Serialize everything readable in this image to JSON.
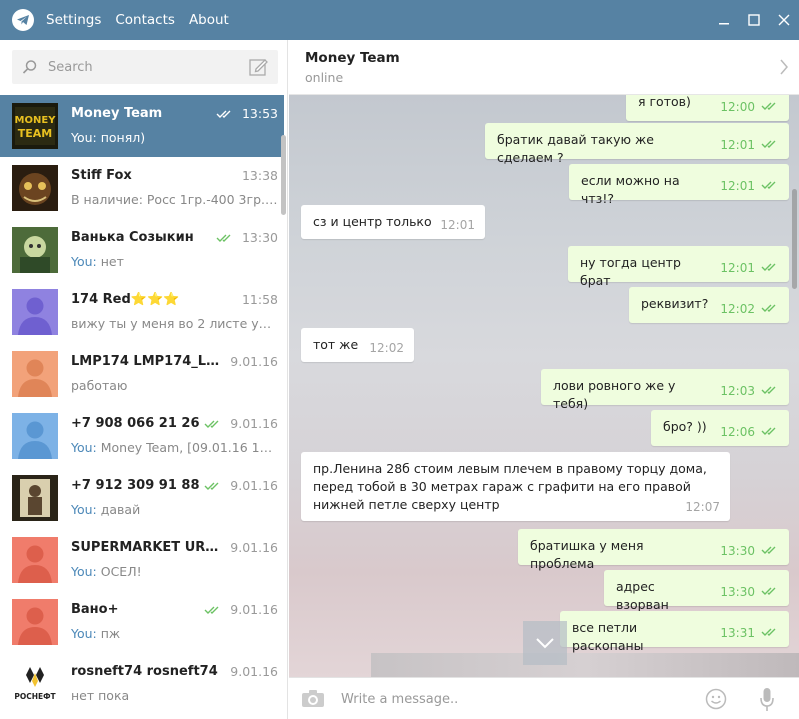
{
  "menu": {
    "settings": "Settings",
    "contacts": "Contacts",
    "about": "About"
  },
  "search": {
    "placeholder": "Search"
  },
  "dialogs": [
    {
      "name": "Money Team",
      "time": "13:53",
      "you": "You:",
      "text": " понял)",
      "read": true,
      "avatar": "money-team"
    },
    {
      "name": "Stiff Fox",
      "time": "13:38",
      "you": "",
      "text": "В наличие: Росс 1гр.-400 3гр.-70...",
      "read": false,
      "avatar": "stiff-fox"
    },
    {
      "name": "Ванька Созыкин",
      "time": "13:30",
      "you": "You:",
      "text": " нет",
      "read": true,
      "avatar": "vanka"
    },
    {
      "name": "174 Red",
      "stars": "⭐⭐⭐",
      "time": "11:58",
      "you": "",
      "text": "вижу ты у меня во 2 листе уже с...",
      "read": false,
      "avatar": "purple"
    },
    {
      "name": "LMP174 LMP174_LEGAL",
      "time": "9.01.16",
      "you": "",
      "text": "работаю",
      "read": false,
      "avatar": "orange"
    },
    {
      "name": "+7 908 066 21 26",
      "time": "9.01.16",
      "you": "You:",
      "text": " Money Team, [09.01.16 15:5...",
      "read": true,
      "avatar": "blue"
    },
    {
      "name": "+7 912 309 91 88",
      "time": "9.01.16",
      "you": "You:",
      "text": " давай",
      "read": true,
      "avatar": "photo"
    },
    {
      "name": "SUPERMARKET URAL...",
      "time": "9.01.16",
      "you": "You:",
      "text": " ОСЕЛ!",
      "read": false,
      "avatar": "red"
    },
    {
      "name": "Вано+",
      "time": "9.01.16",
      "you": "You:",
      "text": " пж",
      "read": true,
      "avatar": "red"
    },
    {
      "name": "rosneft74 rosneft74",
      "time": "9.01.16",
      "you": "",
      "text": "нет пока",
      "read": false,
      "avatar": "rosneft"
    }
  ],
  "avatar_labels": {
    "money_team_line1": "MONEY",
    "money_team_line2": "TEAM",
    "rosneft": "РОСНЕФТ"
  },
  "chat": {
    "title": "Money Team",
    "status": "online"
  },
  "messages": [
    {
      "dir": "out",
      "text": "я готов)",
      "time": "12:00"
    },
    {
      "dir": "out",
      "text": "братик давай такую же сделаем ?",
      "time": "12:01"
    },
    {
      "dir": "out",
      "text": "если можно на чтз!?",
      "time": "12:01"
    },
    {
      "dir": "in",
      "text": "сз и центр только",
      "time": "12:01"
    },
    {
      "dir": "out",
      "text": "ну тогда центр брат",
      "time": "12:01"
    },
    {
      "dir": "out",
      "text": "реквизит?",
      "time": "12:02"
    },
    {
      "dir": "in",
      "text": "тот же",
      "time": "12:02"
    },
    {
      "dir": "out",
      "text": "лови ровного же у тебя)",
      "time": "12:03"
    },
    {
      "dir": "out",
      "text": "бро? ))",
      "time": "12:06"
    },
    {
      "dir": "in",
      "text": "пр.Ленина 28б стоим левым плечем в правому торцу дома, перед тобой в 30 метрах гараж с графити на его правой нижней петле сверху центр",
      "time": "12:07"
    },
    {
      "dir": "out",
      "text": "братишка у меня проблема",
      "time": "13:30"
    },
    {
      "dir": "out",
      "text": "адрес взорван",
      "time": "13:30"
    },
    {
      "dir": "out",
      "text": "все петли раскопаны",
      "time": "13:31"
    }
  ],
  "compose": {
    "placeholder": "Write a message.."
  },
  "colors": {
    "header": "#5682a3",
    "active_dialog": "#5682a3",
    "out_bubble": "#effdde",
    "in_bubble": "#ffffff",
    "tick_green": "#6cc264",
    "you_blue": "#4c88b8"
  }
}
